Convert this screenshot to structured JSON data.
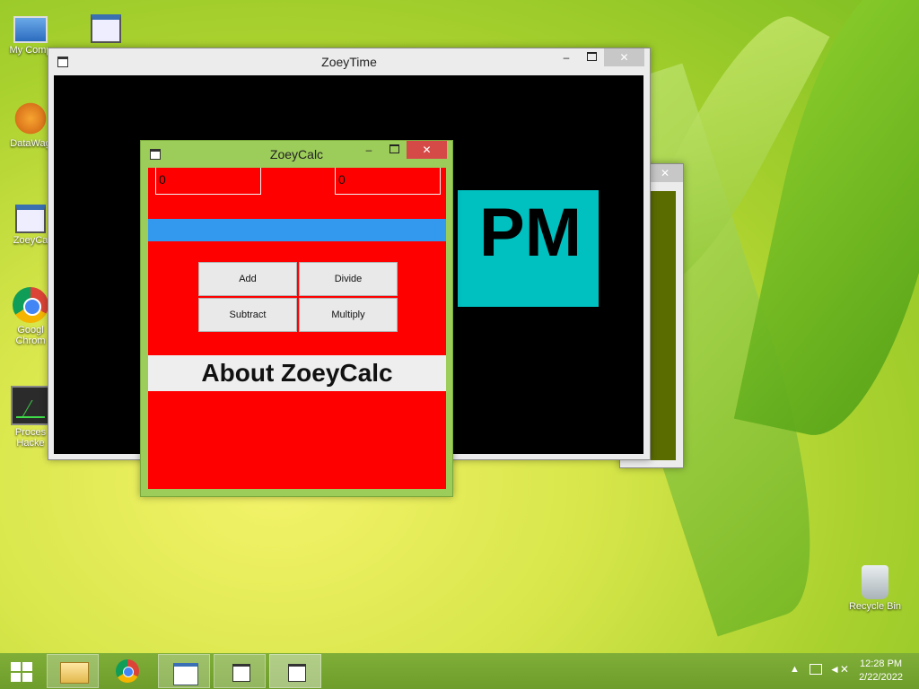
{
  "desktop": {
    "icons": [
      {
        "label": "My Comp",
        "icon": "computer-icon"
      },
      {
        "label": "",
        "icon": "window-icon"
      },
      {
        "label": "DataWag",
        "icon": "datawag-icon"
      },
      {
        "label": "ZoeyCa",
        "icon": "window-icon"
      },
      {
        "label": "Googl",
        "label2": "Chrom",
        "icon": "chrome-icon"
      },
      {
        "label": "Proces",
        "label2": "Hacke",
        "icon": "process-hacker-icon"
      },
      {
        "label": "Recycle Bin",
        "icon": "recycle-bin-icon"
      }
    ]
  },
  "zoeytime": {
    "title": "ZoeyTime",
    "display": "PM",
    "display_bg": "#00c0c0"
  },
  "zoeycalc": {
    "title": "ZoeyCalc",
    "input1": "0",
    "input2": "0",
    "buttons": {
      "add": "Add",
      "divide": "Divide",
      "subtract": "Subtract",
      "multiply": "Multiply"
    },
    "about": "About ZoeyCalc",
    "bg_color": "#ff0000",
    "bar_color": "#3399ee"
  },
  "window_controls": {
    "minimize": "–",
    "close": "✕"
  },
  "taskbar": {
    "items": [
      "start-button",
      "file-explorer",
      "chrome",
      "app",
      "zoeytime",
      "zoeycalc"
    ],
    "time": "12:28 PM",
    "date": "2/22/2022"
  }
}
